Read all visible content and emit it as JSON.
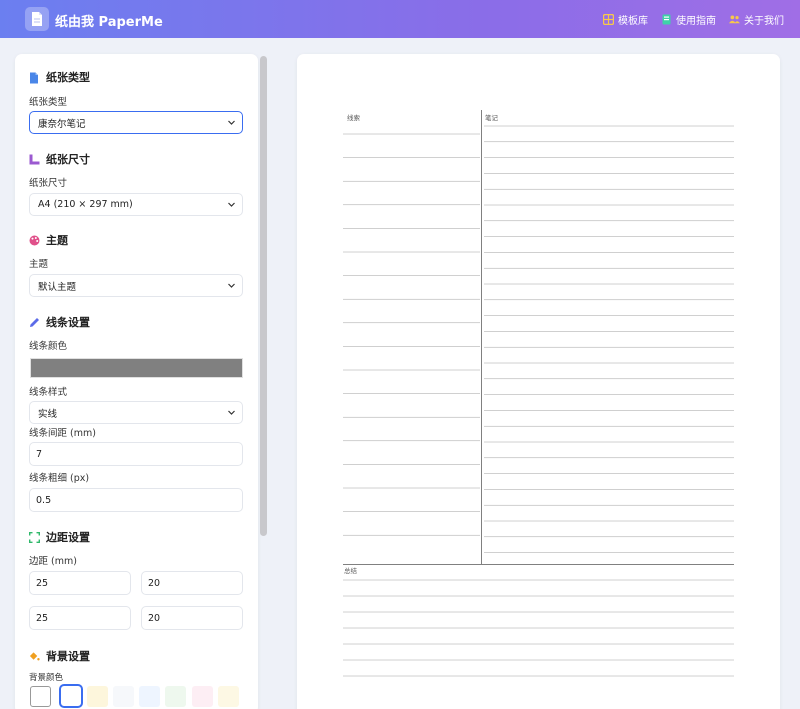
{
  "header": {
    "app_title": "纸由我 PaperMe",
    "nav": [
      {
        "label": "模板库",
        "icon": "grid-icon",
        "color": "#f7c84a"
      },
      {
        "label": "使用指南",
        "icon": "book-icon",
        "color": "#3fd1a8"
      },
      {
        "label": "关于我们",
        "icon": "users-icon",
        "color": "#f7c84a"
      }
    ],
    "gradient": [
      "#6b7ff0",
      "#a06ee6"
    ]
  },
  "sidebar": {
    "paper_type": {
      "title": "纸张类型",
      "icon": "document-icon",
      "icon_color": "#4a86e8",
      "label": "纸张类型",
      "value": "康奈尔笔记"
    },
    "paper_size": {
      "title": "纸张尺寸",
      "icon": "ruler-icon",
      "icon_color": "#9b59d0",
      "label": "纸张尺寸",
      "value": "A4 (210 × 297 mm)"
    },
    "theme": {
      "title": "主题",
      "icon": "palette-icon",
      "icon_color": "#e0508a",
      "label": "主题",
      "value": "默认主题"
    },
    "line_settings": {
      "title": "线条设置",
      "icon": "pencil-icon",
      "icon_color": "#5b6be8",
      "color_label": "线条颜色",
      "color_value": "#808080",
      "style_label": "线条样式",
      "style_value": "实线",
      "spacing_label": "线条间距 (mm)",
      "spacing_value": "7",
      "width_label": "线条粗细 (px)",
      "width_value": "0.5"
    },
    "margin_settings": {
      "title": "边距设置",
      "icon": "frame-icon",
      "icon_color": "#2fb86a",
      "label": "边距 (mm)",
      "values": [
        "25",
        "20",
        "25",
        "20"
      ]
    },
    "background_settings": {
      "title": "背景设置",
      "icon": "paint-bucket-icon",
      "icon_color": "#f0a020",
      "label": "背景颜色",
      "swatches": [
        "#ffffff",
        "#ffffff",
        "#fdf6dc",
        "#f6f8fb",
        "#eef5ff",
        "#eef8ee",
        "#fdeef4",
        "#fdf8e4"
      ]
    }
  },
  "preview": {
    "cue_label": "线索",
    "notes_label": "笔记",
    "summary_label": "总结",
    "line_color": "#808080"
  }
}
